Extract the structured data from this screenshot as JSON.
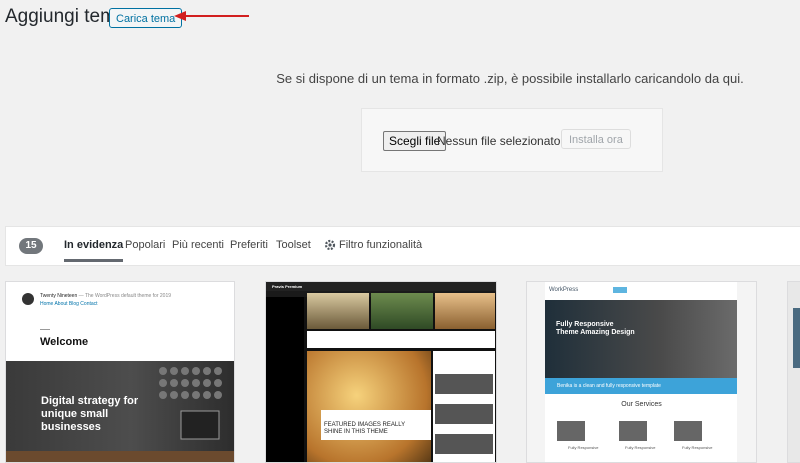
{
  "header": {
    "title": "Aggiungi temi",
    "upload_button": "Carica tema",
    "annotation_color": "#d21f1f"
  },
  "upload": {
    "help_text": "Se si dispone di un tema in formato .zip, è possibile installarlo caricandolo da qui.",
    "choose_file_label": "Scegli file",
    "file_status": "Nessun file selezionato",
    "install_button": "Installa ora"
  },
  "filter": {
    "count": "15",
    "tabs": [
      {
        "label": "In evidenza",
        "current": true
      },
      {
        "label": "Popolari"
      },
      {
        "label": "Più recenti"
      },
      {
        "label": "Preferiti"
      },
      {
        "label": "Toolset"
      }
    ],
    "feature_filter": {
      "label": "Filtro funzionalità",
      "icon": "gear-icon"
    }
  },
  "themes": [
    {
      "site_title": "Twenty Nineteen",
      "tagline": "— The WordPress default theme for 2019",
      "menu": "Home  About  Blog  Contact",
      "welcome": "Welcome",
      "headline": "Digital strategy for unique small businesses"
    },
    {
      "site_title": "Pravis Premium",
      "featured": "FEATURED IMAGES REALLY SHINE IN THIS THEME"
    },
    {
      "logo": "WorkPress",
      "hero_title": "Fully Responsive Theme Amazing Design",
      "bar_text": "Benika is a clean and fully responsive template",
      "services_title": "Our Services",
      "service_label": "Fully Responsive"
    }
  ]
}
